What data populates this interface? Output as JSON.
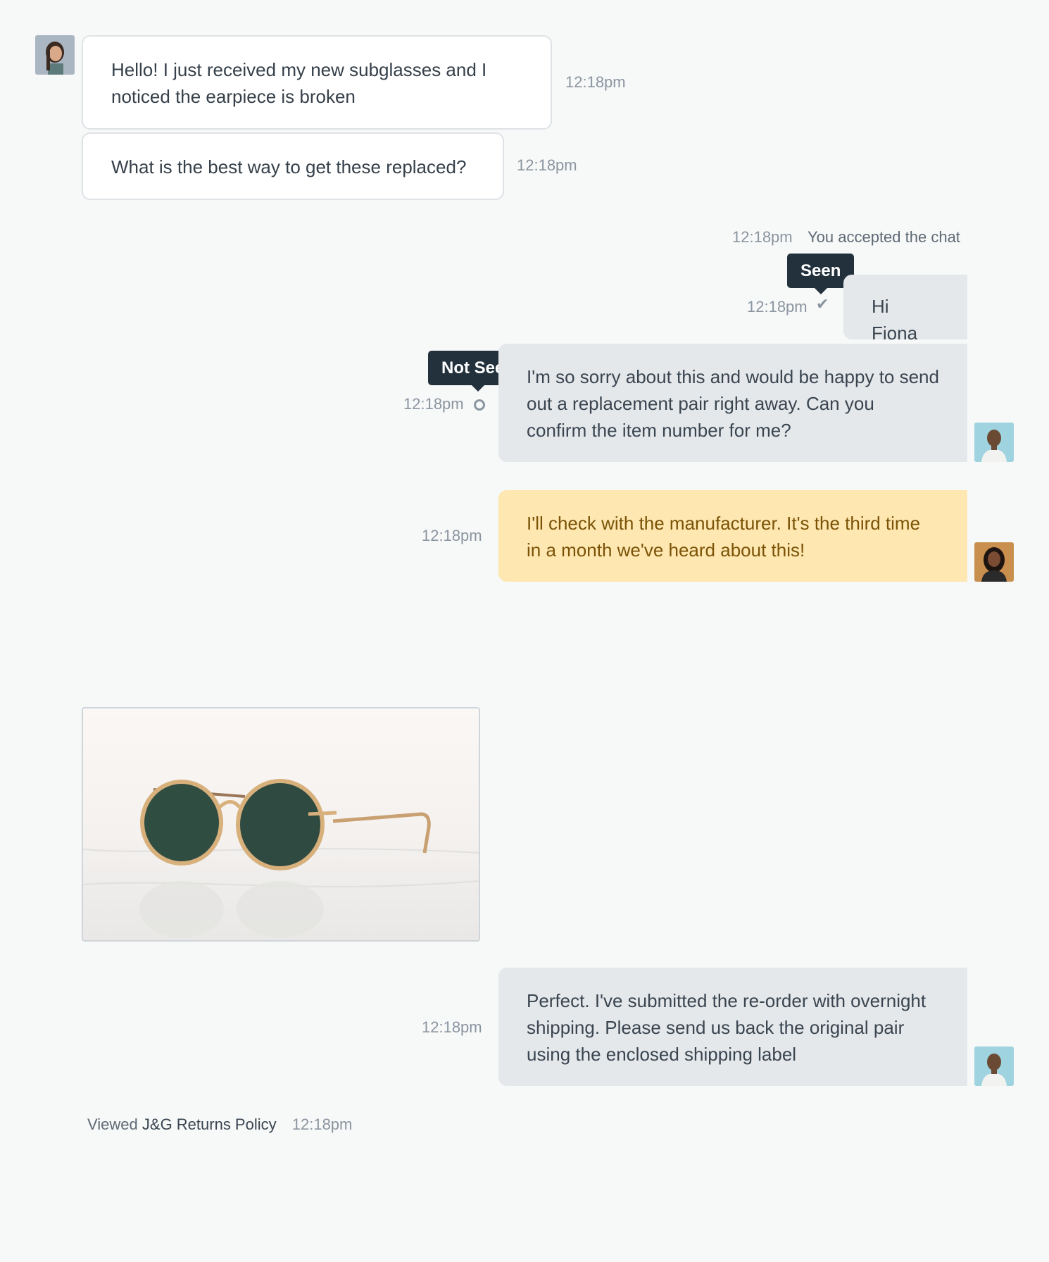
{
  "conversation": {
    "customer_messages": [
      {
        "text": "Hello! I just received my new subglasses and I noticed the earpiece is broken",
        "time": "12:18pm"
      },
      {
        "text": "What is the best way to get these replaced?",
        "time": "12:18pm"
      }
    ],
    "system_event": {
      "time": "12:18pm",
      "text": "You accepted the chat"
    },
    "agent_message_1": {
      "text": "Hi Fiona",
      "time": "12:18pm",
      "status_tooltip": "Seen",
      "status_icon": "check-icon"
    },
    "agent_message_2": {
      "text": "I'm so sorry about this and would be happy to send out a replacement pair right away. Can you confirm the item number for me?",
      "time": "12:18pm",
      "status_tooltip": "Not Seen",
      "status_icon": "unread-circle-icon"
    },
    "internal_note": {
      "text": "I'll check with the manufacturer. It's the third time in a month we've heard about this!",
      "time": "12:18pm"
    },
    "attachment": {
      "time": "",
      "icon": "sunglasses-photo"
    },
    "agent_message_3": {
      "text": "Perfect. I've submitted the re-order with overnight shipping. Please send us back the original pair using the enclosed shipping label",
      "time": "12:18pm"
    },
    "activity": {
      "prefix": "Viewed",
      "link": "J&G Returns Policy",
      "time": "12:18pm"
    }
  },
  "colors": {
    "background": "#f7f8f8",
    "agent_bubble": "#e4e8eb",
    "note_bubble": "#fee7b0",
    "note_text": "#7a5307",
    "tooltip": "#22313c"
  }
}
